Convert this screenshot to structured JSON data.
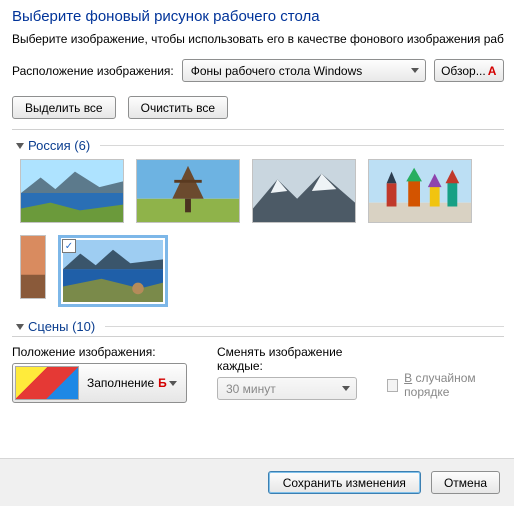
{
  "title": "Выберите фоновый рисунок рабочего стола",
  "description": "Выберите изображение, чтобы использовать его в качестве фонового изображения рабоче выберите несколько изображений, чтобы создать слайд-шоу.",
  "location_label": "Расположение изображения:",
  "location_value": "Фоны рабочего стола Windows",
  "browse_label": "Обзор...",
  "marker_a": "А",
  "select_all": "Выделить все",
  "clear_all": "Очистить все",
  "groups": [
    {
      "name": "Россия",
      "count": 6
    },
    {
      "name": "Сцены",
      "count": 10
    }
  ],
  "position": {
    "label": "Положение изображения:",
    "value": "Заполнение",
    "marker": "Б"
  },
  "interval": {
    "label1": "Сменять изображение",
    "label2": "каждые:",
    "value": "30 минут"
  },
  "shuffle": {
    "label_pre": "В",
    "label_rest": " случайном порядке"
  },
  "footer": {
    "save": "Сохранить изменения",
    "cancel": "Отмена"
  }
}
